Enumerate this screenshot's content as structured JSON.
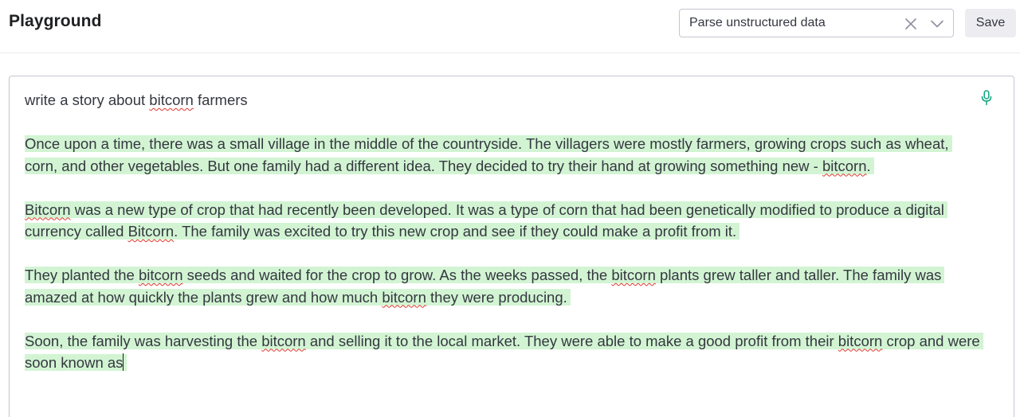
{
  "header": {
    "title": "Playground",
    "preset": {
      "value": "Parse unstructured data",
      "clear_icon": "close-icon",
      "dropdown_icon": "chevron-down-icon"
    },
    "save_label": "Save"
  },
  "editor": {
    "mic_icon": "microphone-icon",
    "prompt": [
      {
        "t": "write a story about "
      },
      {
        "t": "bitcorn",
        "spell": true
      },
      {
        "t": " farmers"
      }
    ],
    "generated": [
      [
        {
          "t": "Once upon a time, there was a small village in the middle of the countryside. The villagers were mostly farmers, growing crops such as wheat, corn, and other vegetables. But one family had a different idea. They decided to try their hand at growing something new - "
        },
        {
          "t": "bitcorn",
          "spell": true
        },
        {
          "t": "."
        }
      ],
      [
        {
          "t": "Bitcorn",
          "spell": true
        },
        {
          "t": " was a new type of crop that had recently been developed. It was a type of corn that had been genetically modified to produce a digital currency called "
        },
        {
          "t": "Bitcorn",
          "spell": true
        },
        {
          "t": ". The family was excited to try this new crop and see if they could make a profit from it."
        }
      ],
      [
        {
          "t": "They planted the "
        },
        {
          "t": "bitcorn",
          "spell": true
        },
        {
          "t": " seeds and waited for the crop to grow. As the weeks passed, the "
        },
        {
          "t": "bitcorn",
          "spell": true
        },
        {
          "t": " plants grew taller and taller. The family was amazed at how quickly the plants grew and how much "
        },
        {
          "t": "bitcorn",
          "spell": true
        },
        {
          "t": " they were producing."
        }
      ],
      [
        {
          "t": "Soon, the family was harvesting the "
        },
        {
          "t": "bitcorn",
          "spell": true
        },
        {
          "t": " and selling it to the local market. They were able to make a good profit from their "
        },
        {
          "t": "bitcorn",
          "spell": true
        },
        {
          "t": " crop and were soon known as"
        }
      ]
    ]
  },
  "colors": {
    "highlight": "#d2f4d3",
    "spellcheck": "#e0362c",
    "border": "#c5c5d2",
    "button_bg": "#ececf1"
  }
}
